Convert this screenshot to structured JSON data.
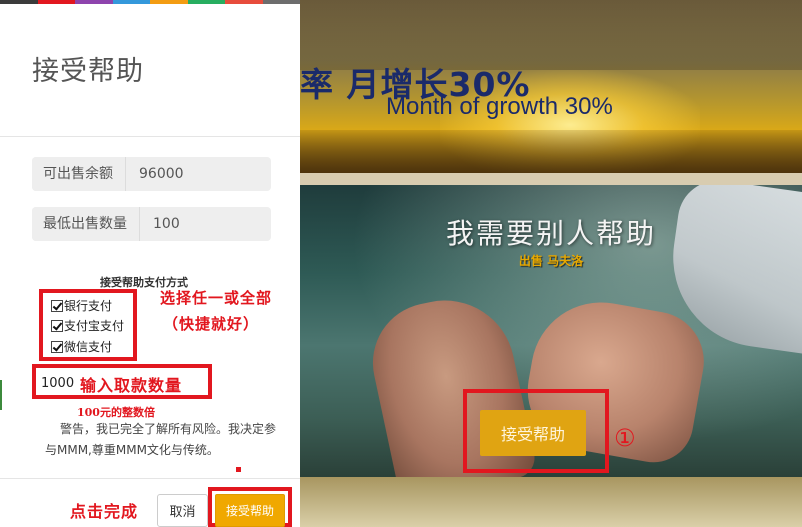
{
  "background": {
    "banner": {
      "headline_zh": "率  月增长30%",
      "headline_en": "Month of growth 30%"
    },
    "hero": {
      "title": "我需要别人帮助",
      "subtitle": "出售 马夫洛",
      "button_label": "接受帮助"
    }
  },
  "modal": {
    "title": "接受帮助",
    "rainbow_colors": [
      "#3b3b3b",
      "#e2171f",
      "#8e44ad",
      "#3498db",
      "#f39c12",
      "#27ae60",
      "#e74c3c",
      "#6d6d6d"
    ],
    "fields": {
      "available_label": "可出售余额",
      "available_value": "96000",
      "min_label": "最低出售数量",
      "min_value": "100"
    },
    "payment": {
      "title": "接受帮助支付方式",
      "options": [
        {
          "label": "银行支付",
          "checked": true
        },
        {
          "label": "支付宝支付",
          "checked": true
        },
        {
          "label": "微信支付",
          "checked": true
        }
      ]
    },
    "amount_value": "1000",
    "warning": "警告，我已完全了解所有风险。我决定参与MMM,尊重MMM文化与传统。",
    "footer": {
      "cancel_label": "取消",
      "accept_label": "接受帮助"
    }
  },
  "annotations": {
    "select_any": "选择任一或全部",
    "fast": "（快捷就好）",
    "enter_amount": "输入取款数量",
    "multiple_hint": "100元的整数倍",
    "click_done": "点击完成",
    "step_marker": "①",
    "color": "#e2171f"
  }
}
